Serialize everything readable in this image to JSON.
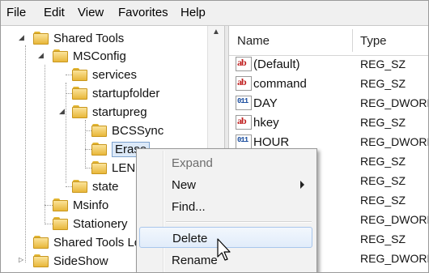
{
  "menubar": {
    "items": [
      "File",
      "Edit",
      "View",
      "Favorites",
      "Help"
    ]
  },
  "tree": {
    "items": [
      {
        "label": "Shared Tools"
      },
      {
        "label": "MSConfig"
      },
      {
        "label": "services"
      },
      {
        "label": "startupfolder"
      },
      {
        "label": "startupreg"
      },
      {
        "label": "BCSSync"
      },
      {
        "label": "Erase"
      },
      {
        "label": "LEN"
      },
      {
        "label": "state"
      },
      {
        "label": "Msinfo"
      },
      {
        "label": "Stationery"
      },
      {
        "label": "Shared Tools Lo"
      },
      {
        "label": "SideShow"
      }
    ]
  },
  "list": {
    "columns": {
      "name": "Name",
      "type": "Type"
    },
    "rows": [
      {
        "name": "(Default)",
        "type": "REG_SZ",
        "icon": "string-value-icon"
      },
      {
        "name": "command",
        "type": "REG_SZ",
        "icon": "string-value-icon"
      },
      {
        "name": "DAY",
        "type": "REG_DWORD",
        "icon": "binary-value-icon"
      },
      {
        "name": "hkey",
        "type": "REG_SZ",
        "icon": "string-value-icon"
      },
      {
        "name": "HOUR",
        "type": "REG_DWORD",
        "icon": "binary-value-icon"
      },
      {
        "name": "",
        "type": "REG_SZ",
        "icon": ""
      },
      {
        "name": "",
        "type": "REG_SZ",
        "icon": ""
      },
      {
        "name": "",
        "type": "REG_SZ",
        "icon": ""
      },
      {
        "name": "",
        "type": "REG_DWORD",
        "icon": ""
      },
      {
        "name": "",
        "type": "REG_SZ",
        "icon": ""
      },
      {
        "name": "",
        "type": "REG_DWORD",
        "icon": ""
      },
      {
        "name": "",
        "type": "REG_DWORD",
        "icon": ""
      }
    ]
  },
  "context_menu": {
    "items": {
      "expand": "Expand",
      "new": "New",
      "find": "Find...",
      "delete": "Delete",
      "rename": "Rename"
    }
  }
}
